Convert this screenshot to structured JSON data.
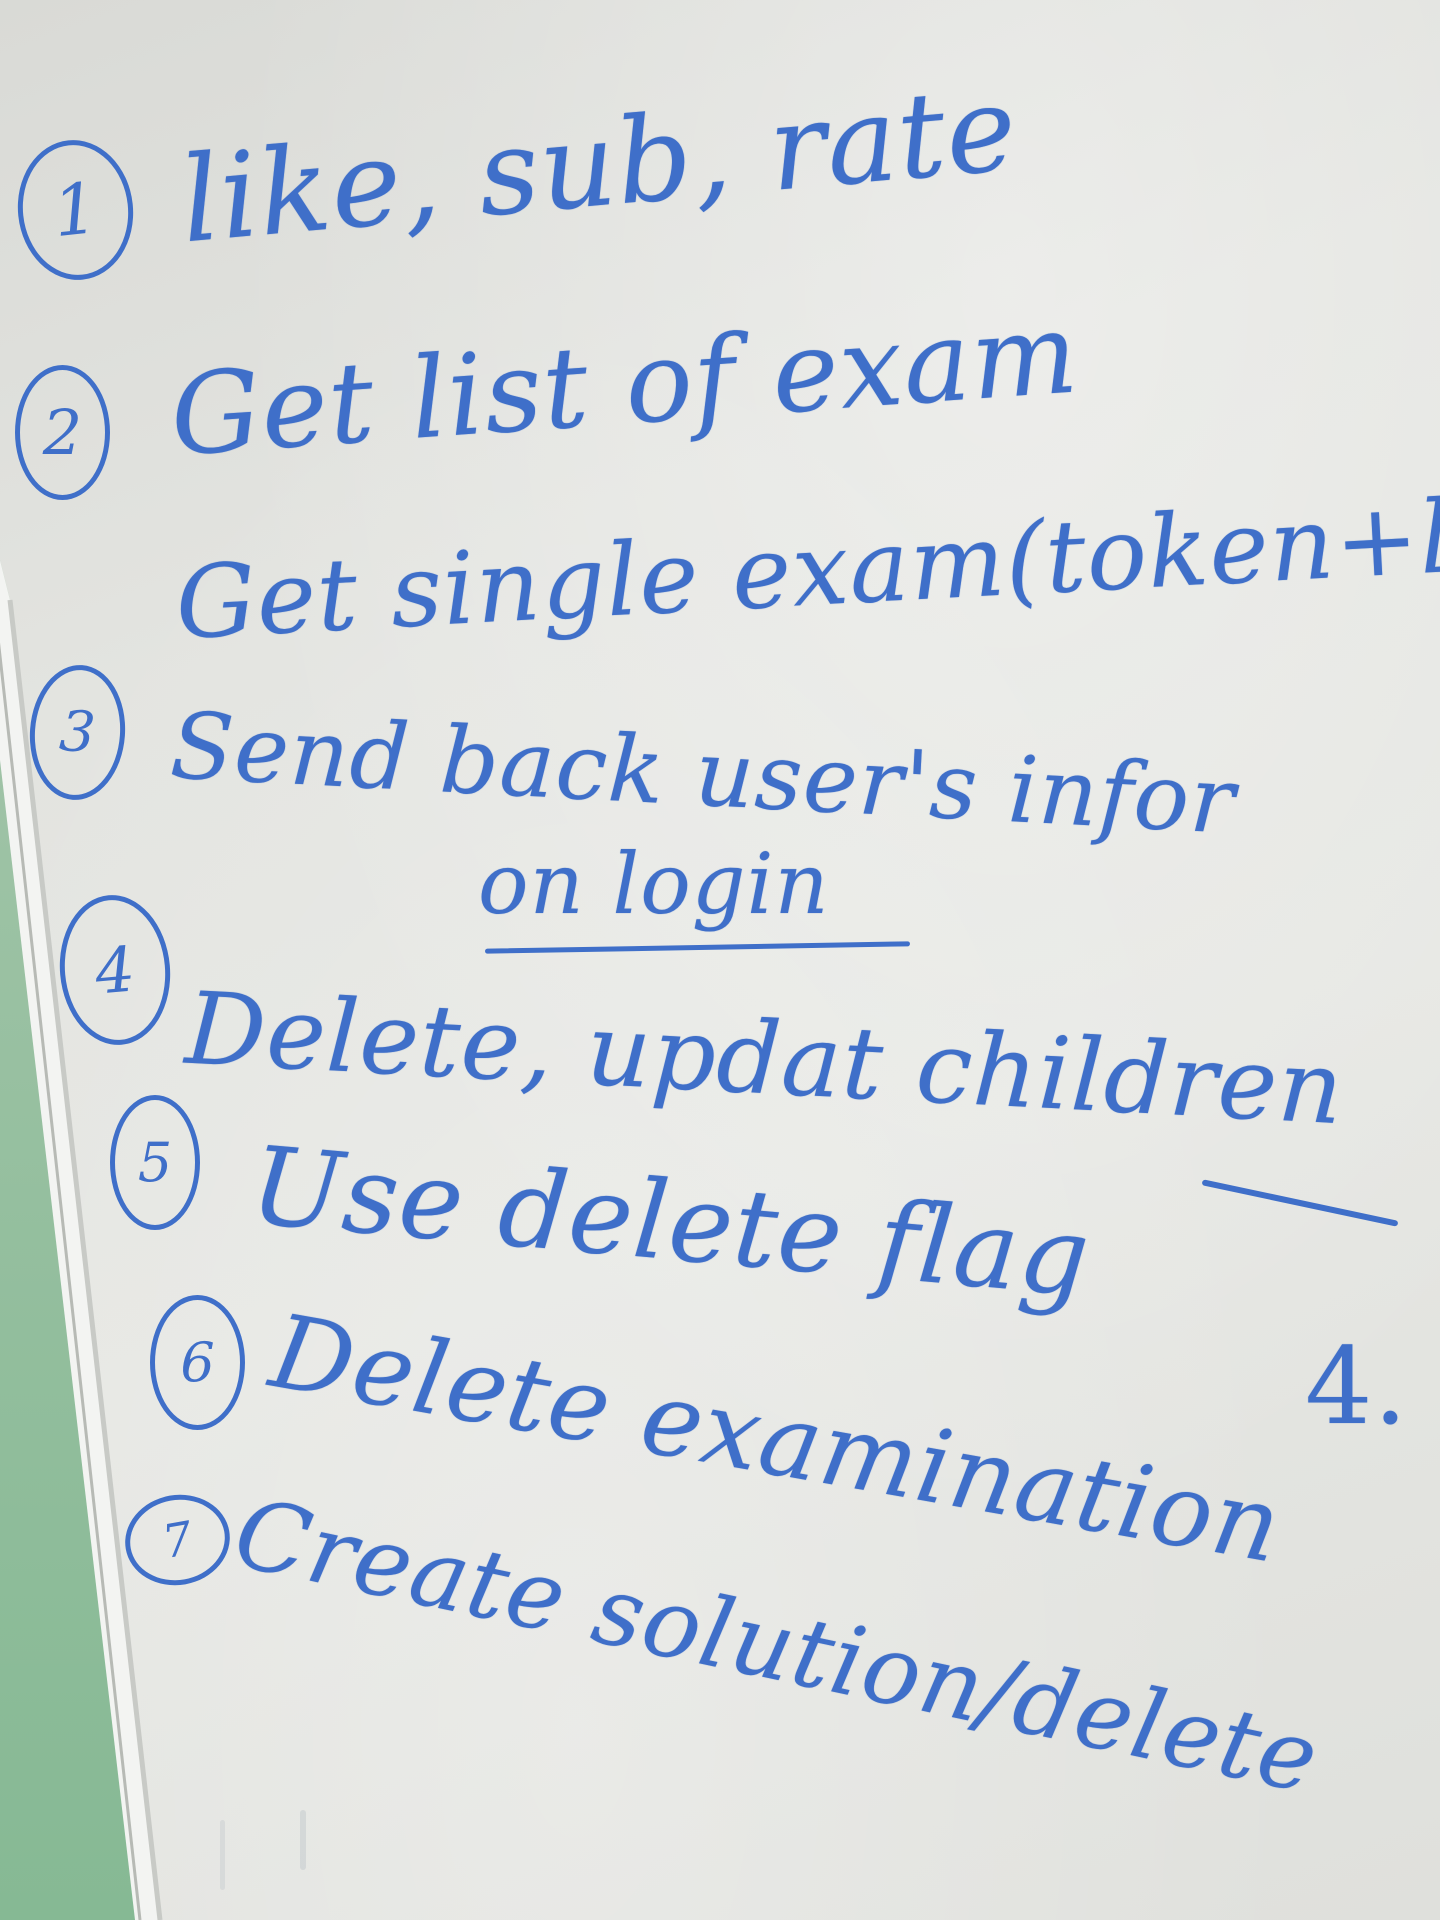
{
  "lines": [
    "like, sub, rate",
    "Get list of exam",
    "Get single exam(token+le",
    "Send back user's infor",
    "on login",
    "Delete, updat children",
    "Use delete flag",
    "Delete examination",
    "Create solution/delete",
    "4."
  ],
  "numbers": [
    "1",
    "2",
    "3",
    "4",
    "5",
    "6",
    "7"
  ],
  "colors": {
    "marker": "#3f6fc9",
    "board": "#e3e4e0",
    "wall": "#9cc2a4"
  }
}
